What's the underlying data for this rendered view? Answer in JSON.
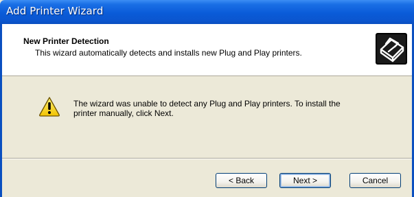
{
  "window": {
    "title": "Add Printer Wizard"
  },
  "header": {
    "title": "New Printer Detection",
    "subtitle": "This wizard automatically detects and installs new Plug and Play printers.",
    "icon": "printer-icon"
  },
  "message": {
    "icon": "warning-icon",
    "line1": "The wizard was unable to detect any Plug and Play printers. To install the",
    "line2": "printer manually, click Next."
  },
  "buttons": {
    "back_label": "< Back",
    "next_label": "Next >",
    "cancel_label": "Cancel"
  },
  "colors": {
    "titlebar": "#0a5bd8",
    "dialog_background": "#ece9d8",
    "header_background": "#ffffff",
    "warning_yellow": "#f7d417"
  }
}
